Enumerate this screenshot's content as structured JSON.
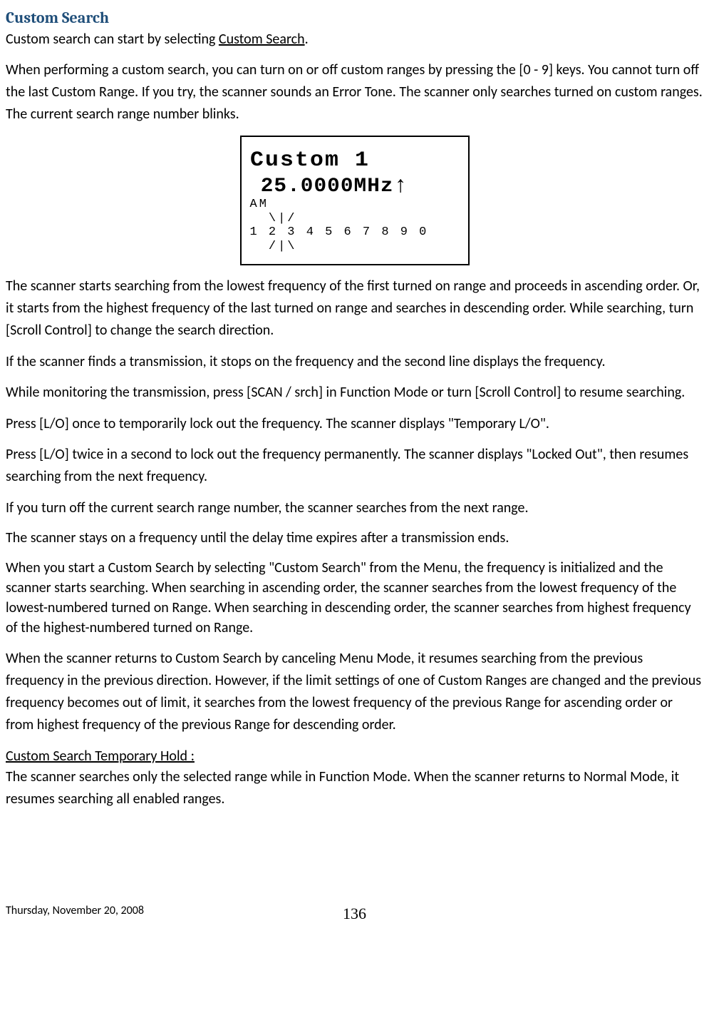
{
  "heading": "Custom Search",
  "intro_line1_a": "Custom search can start by selecting ",
  "intro_line1_link": "Custom Search",
  "intro_line1_b": ".",
  "para1": "When performing a custom search, you can turn on or off custom ranges by pressing the [0 - 9] keys. You cannot turn off the last Custom Range. If you try, the scanner sounds an Error Tone. The scanner only searches turned on custom ranges. The current search range number blinks.",
  "lcd": {
    "line1": "Custom 1",
    "line2": "25.0000MHz",
    "arrow": "↑",
    "mode": "AM",
    "mark_top": "  \\|/",
    "numbers": "1 2 3 4 5 6 7 8 9 0",
    "mark_bot": "  /|\\"
  },
  "para2": "The scanner starts searching from the lowest frequency of the first turned on range and proceeds in ascending order. Or, it starts from the highest frequency of the last turned on range and searches in descending order. While searching, turn [Scroll Control] to change the search direction.",
  "para3": "If the scanner finds a transmission, it stops on the frequency and the second line displays the frequency.",
  "para4": "While monitoring the transmission, press [SCAN / srch] in Function Mode or turn [Scroll Control] to resume searching.",
  "para5": "Press [L/O] once to temporarily lock out the frequency. The scanner displays \"Temporary L/O\".",
  "para6": "Press [L/O] twice in a second to lock out the frequency permanently. The scanner displays \"Locked Out\", then resumes searching from the next frequency.",
  "para7": "If you turn off the current search range number, the scanner searches from the next range.",
  "para8": "The scanner stays on a frequency until the delay time expires after a transmission ends.",
  "para9": "When you start a Custom Search by selecting \"Custom Search\" from the Menu, the frequency is initialized and the scanner starts searching. When searching in ascending order, the scanner searches from the lowest frequency of the lowest-numbered turned on Range. When searching in descending order, the scanner searches from highest frequency of the highest-numbered turned on Range.",
  "para10": "When the scanner returns to Custom Search by canceling Menu Mode, it resumes searching from the previous frequency in the previous direction. However, if the limit settings of one of Custom Ranges are changed and the previous frequency becomes out of limit, it searches from the lowest frequency of the previous Range for ascending order or from highest frequency of the previous Range for descending order.",
  "subheading": "Custom Search Temporary Hold :",
  "para11": "The scanner searches only the selected range while in Function Mode. When the scanner returns to Normal Mode, it resumes searching all enabled ranges.",
  "footer_date": "Thursday, November 20, 2008",
  "footer_page": "136"
}
